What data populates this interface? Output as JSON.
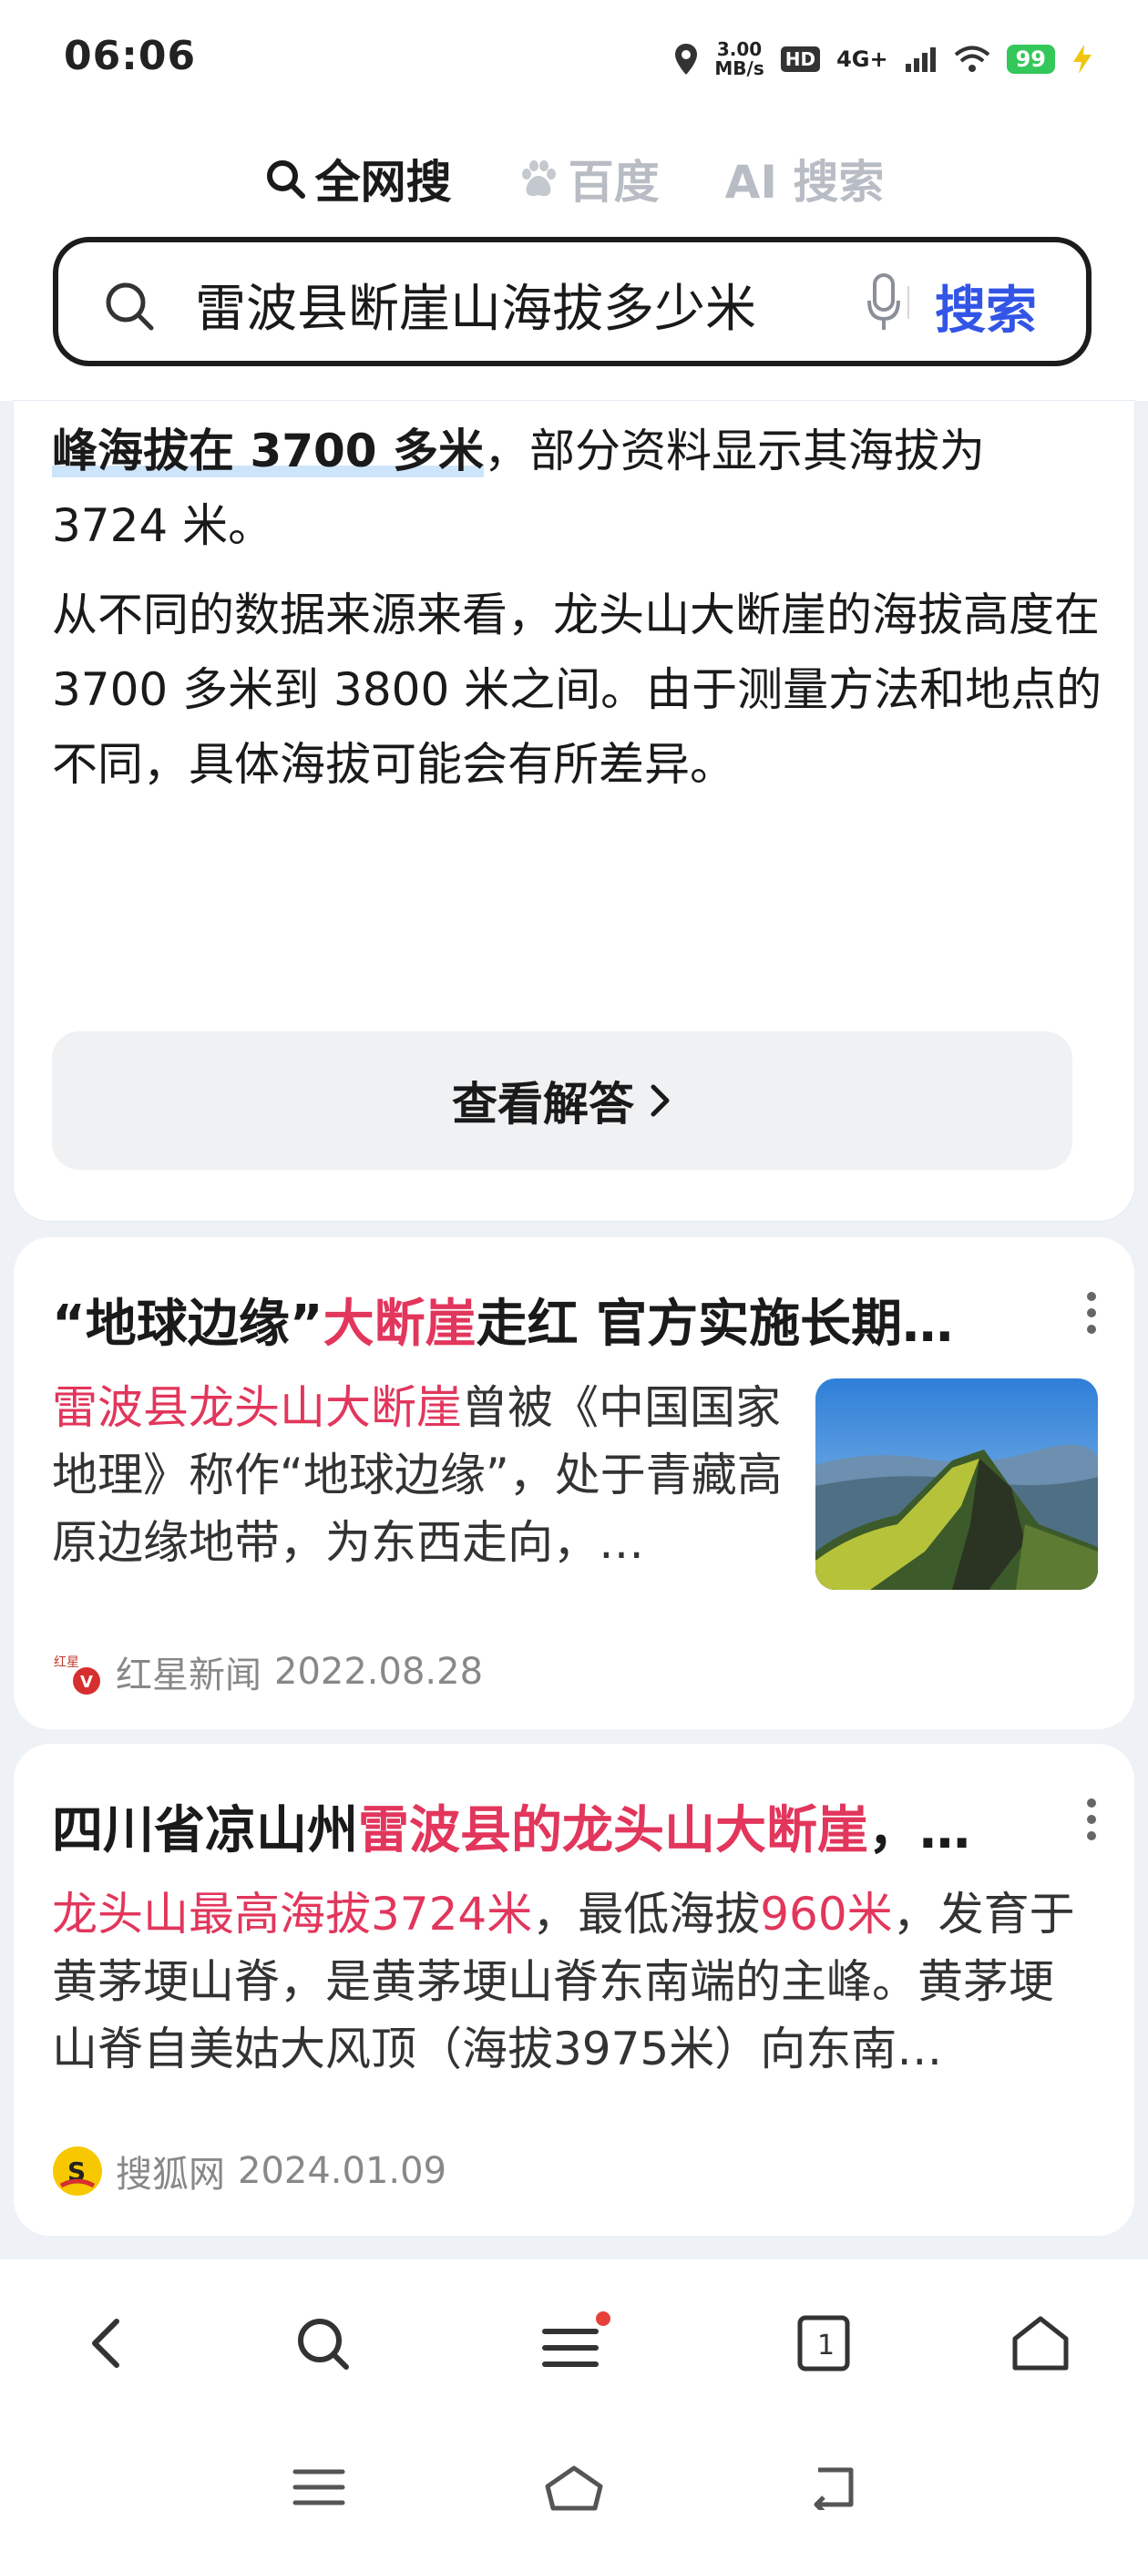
{
  "status_bar": {
    "time": "06:06",
    "speed_value": "3.00",
    "speed_unit": "MB/s",
    "hd": "HD",
    "network": "4G+",
    "battery": "99"
  },
  "tabs": [
    {
      "label": "全网搜",
      "active": true
    },
    {
      "label": "百度",
      "active": false
    },
    {
      "label": "AI 搜索",
      "active": false
    }
  ],
  "search": {
    "query": "雷波县断崖山海拔多少米",
    "button": "搜索"
  },
  "answer": {
    "line1_highlight": "峰海拔在 3700 多米",
    "line1_rest": "，部分资料显示其海拔为",
    "line2": "3724 米。",
    "para2": "从不同的数据来源来看，龙头山大断崖的海拔高度在 3700 多米到 3800 米之间。由于测量方法和地点的不同，具体海拔可能会有所差异。",
    "view_button": "查看解答"
  },
  "results": [
    {
      "title_pre": "“地球边缘”",
      "title_hl": "大断崖",
      "title_post": "走红 官方实施长期…",
      "snippet_hl": "雷波县龙头山大断崖",
      "snippet_rest": "曾被《中国国家地理》称作“地球边缘”，处于青藏高原边缘地带，为东西走向，…",
      "source": "红星新闻",
      "date": "2022.08.28"
    },
    {
      "title_pre": "四川省凉山州",
      "title_hl": "雷波县的龙头山大断崖",
      "title_post": "，…",
      "snippet_hl1": "龙头山最高海拔3724米",
      "snippet_mid": "，最低海拔",
      "snippet_hl2": "960米",
      "snippet_rest": "，发育于黄茅埂山脊，是黄茅埂山脊东南端的主峰。黄茅埂山脊自美姑大风顶（海拔3975米）向东南…",
      "source": "搜狐网",
      "date": "2024.01.09"
    }
  ],
  "bottom_nav": {
    "tab_count": "1"
  },
  "colors": {
    "accent_blue": "#3355e6",
    "highlight_red": "#e2365c",
    "notification_dot": "#e8413b"
  },
  "icons": [
    "location-icon",
    "hd-icon",
    "signal-icon",
    "wifi-icon",
    "battery-icon",
    "charging-icon",
    "search-icon",
    "baidu-paw-icon",
    "microphone-icon",
    "chevron-right-icon",
    "more-vertical-icon",
    "hongxing-logo-icon",
    "sohu-logo-icon",
    "back-icon",
    "menu-icon",
    "tabs-icon",
    "home-icon"
  ]
}
